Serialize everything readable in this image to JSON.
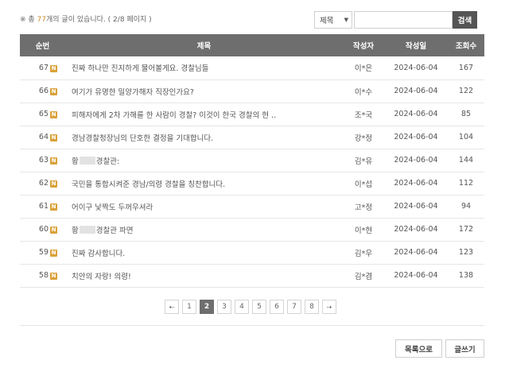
{
  "info": {
    "prefix": "※ 총 ",
    "count": "77",
    "suffix": "개의 글이 있습니다. ( 2/8 페이지 )"
  },
  "search": {
    "field_selected": "제목",
    "input_value": "",
    "button_label": "검색"
  },
  "table": {
    "headers": [
      "순번",
      "제목",
      "작성자",
      "작성일",
      "조회수"
    ],
    "new_badge": "N",
    "rows": [
      {
        "no": "67",
        "title": "진짜 하나만 진지하게 물어볼게요. 경찰님들",
        "author": "이*은",
        "date": "2024-06-04",
        "views": "167"
      },
      {
        "no": "66",
        "title": "여기가 유명한 밀양가해자 직장인가요?",
        "author": "이*수",
        "date": "2024-06-04",
        "views": "122"
      },
      {
        "no": "65",
        "title": "피해자에게 2차 가해를 한 사람이 경찰? 이것이 한국 경찰의 현 ..",
        "author": "조*국",
        "date": "2024-06-04",
        "views": "85"
      },
      {
        "no": "64",
        "title": "경남경찰청장님의 단호한 결정을 기대합니다.",
        "author": "강*정",
        "date": "2024-06-04",
        "views": "104"
      },
      {
        "no": "63",
        "title_a": "황",
        "title_b": "경찰관:",
        "author": "김*유",
        "date": "2024-06-04",
        "views": "144"
      },
      {
        "no": "62",
        "title": "국민을 통합시켜준 경남/의령 경찰을 칭찬합니다.",
        "author": "이*섭",
        "date": "2024-06-04",
        "views": "112"
      },
      {
        "no": "61",
        "title": "어이구 낯짝도 두꺼우셔라",
        "author": "고*정",
        "date": "2024-06-04",
        "views": "94"
      },
      {
        "no": "60",
        "title_a": "황",
        "title_b": "경찰관 파면",
        "author": "이*현",
        "date": "2024-06-04",
        "views": "172"
      },
      {
        "no": "59",
        "title": "진짜 감사합니다.",
        "author": "김*우",
        "date": "2024-06-04",
        "views": "123"
      },
      {
        "no": "58",
        "title": "치안의 자랑! 의령!",
        "author": "김*겸",
        "date": "2024-06-04",
        "views": "138"
      }
    ]
  },
  "pager": {
    "prev": "⇠",
    "next": "⇢",
    "pages": [
      "1",
      "2",
      "3",
      "4",
      "5",
      "6",
      "7",
      "8"
    ],
    "current": "2"
  },
  "buttons": {
    "list": "목록으로",
    "write": "글쓰기"
  }
}
